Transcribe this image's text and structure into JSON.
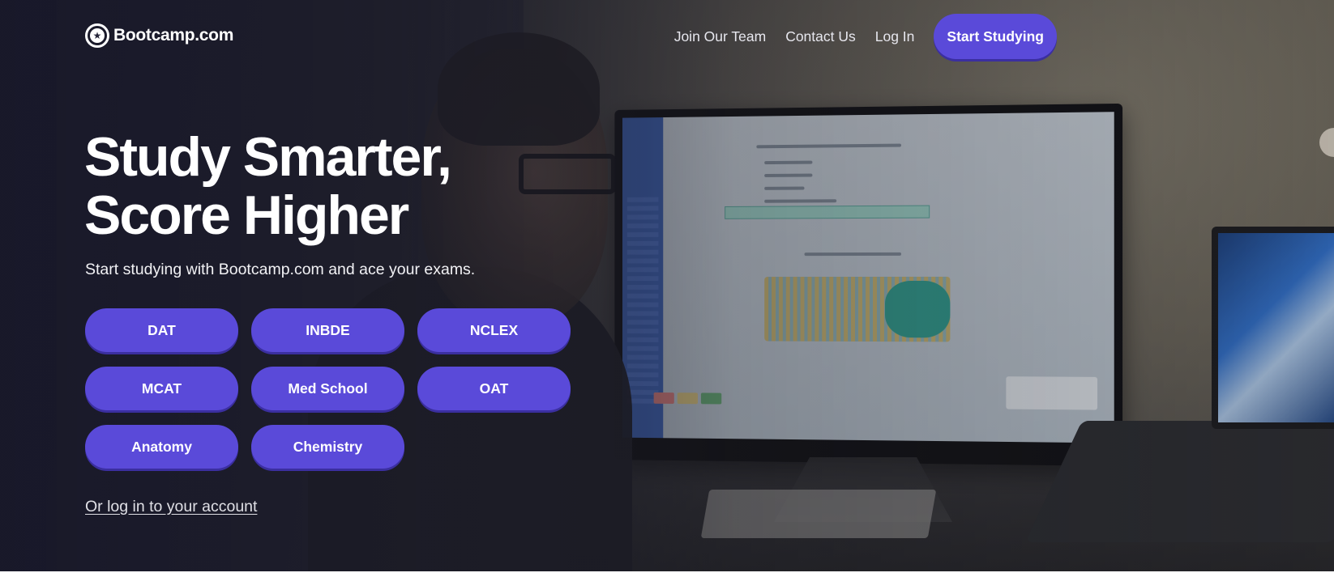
{
  "brand": {
    "name": "Bootcamp.com",
    "logo_icon": "star-circle-icon"
  },
  "nav": {
    "links": [
      "Join Our Team",
      "Contact Us",
      "Log In"
    ],
    "cta_label": "Start Studying"
  },
  "hero": {
    "headline_line1": "Study Smarter,",
    "headline_line2": "Score Higher",
    "subtitle": "Start studying with Bootcamp.com and ace your exams.",
    "exams": [
      "DAT",
      "INBDE",
      "NCLEX",
      "MCAT",
      "Med School",
      "OAT",
      "Anatomy",
      "Chemistry"
    ],
    "login_link": "Or log in to your account"
  },
  "colors": {
    "accent": "#5a4ad9",
    "accent_shadow": "#3b2fa0",
    "overlay": "#1c1c28"
  }
}
